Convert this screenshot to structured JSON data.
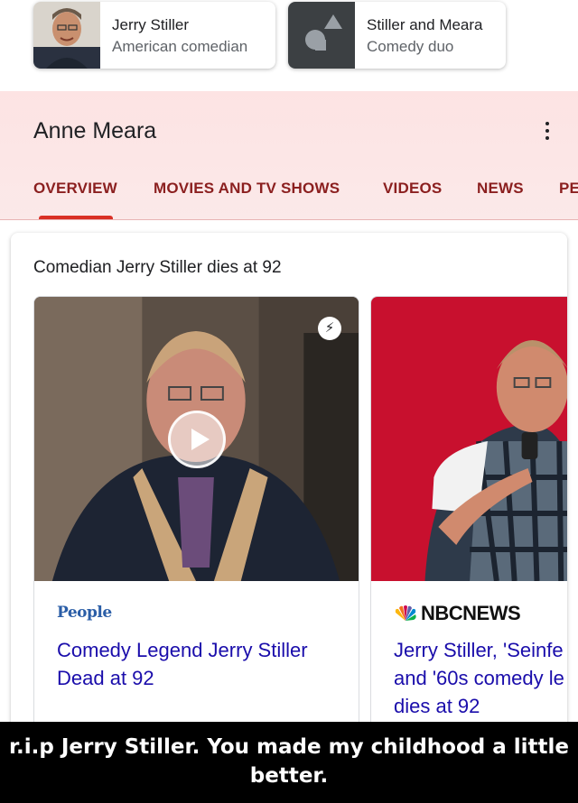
{
  "related_chips": [
    {
      "title": "Jerry Stiller",
      "subtitle": "American comedian",
      "thumb_icon": "person-photo"
    },
    {
      "title": "Stiller and Meara",
      "subtitle": "Comedy duo",
      "thumb_icon": "shapes-placeholder-icon"
    }
  ],
  "knowledge_panel": {
    "title": "Anne Meara",
    "menu_icon": "more-vert-icon",
    "tabs": [
      "OVERVIEW",
      "MOVIES AND TV SHOWS",
      "VIDEOS",
      "NEWS",
      "PE"
    ],
    "active_tab_index": 0,
    "accent_color": "#d93025"
  },
  "top_stories": {
    "heading": "Comedian Jerry Stiller dies at 92",
    "articles": [
      {
        "source": "People",
        "headline_lines": [
          "Comedy Legend Jerry Stiller",
          "Dead at 92"
        ],
        "has_video": true,
        "amp_icon": "bolt-icon"
      },
      {
        "source": "NBCNEWS",
        "headline_lines": [
          "Jerry Stiller, 'Seinfe",
          "and '60s comedy le",
          "dies at 92"
        ],
        "has_video": false
      }
    ]
  },
  "caption": {
    "lines": [
      "r.i.p Jerry Stiller. You made my childhood a little",
      "better."
    ]
  },
  "colors": {
    "link": "#1a0dab",
    "tab_text": "#8b1f1f",
    "header_bg": "#fde3e3"
  }
}
